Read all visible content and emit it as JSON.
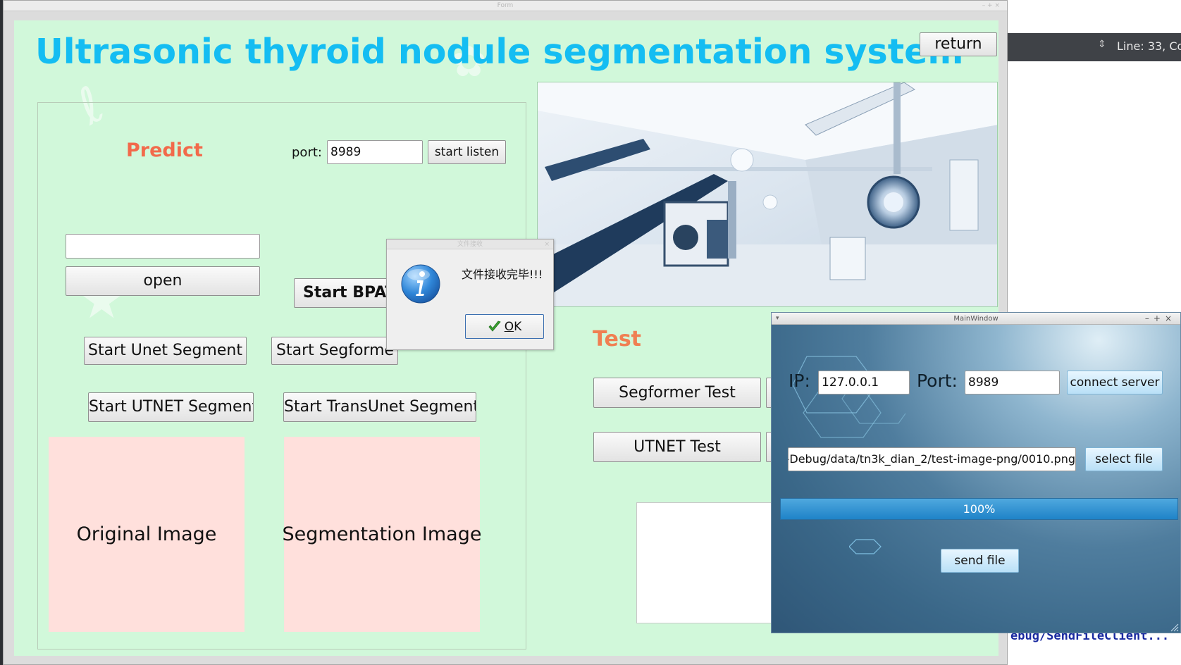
{
  "form": {
    "window_title": "Form",
    "title": "Ultrasonic thyroid nodule segmentation system",
    "return_label": "return",
    "predict_label": "Predict",
    "port_label": "port:",
    "port_value": "8989",
    "start_listen_label": "start listen",
    "file_path_value": "",
    "open_label": "open",
    "bpat_label": "Start BPAT-",
    "unet_label": "Start Unet Segment",
    "segformer_label": "Start Segforme",
    "utnet_label": "Start UTNET Segment",
    "transunet_label": "Start TransUnet Segment",
    "original_image_label": "Original Image",
    "segmentation_image_label": "Segmentation Image",
    "test_label": "Test",
    "segformer_test_label": "Segformer Test",
    "utnet_test_label": "UTNET Test"
  },
  "message_box": {
    "title": "文件接收",
    "text": "文件接收完毕!!!",
    "ok_mnemonic": "O",
    "ok_rest": "K",
    "icon": "info-icon"
  },
  "client": {
    "window_title": "MainWindow",
    "ip_label": "IP:",
    "ip_value": "127.0.0.1",
    "port_label": "Port:",
    "port_value": "8989",
    "connect_label": "connect server",
    "path_value": "-Debug/data/tn3k_dian_2/test-image-png/0010.png",
    "select_file_label": "select file",
    "progress": 100,
    "progress_text": "100%",
    "send_file_label": "send file"
  },
  "editor": {
    "line_col": "Line: 33, Co",
    "path_snippet": "ebug/SendFileClient..."
  },
  "colors": {
    "title": "#14bdf2",
    "predict": "#f26a4b",
    "test": "#f07f52",
    "form_background": "#d1f8da",
    "image_box": "#ffe0dc"
  }
}
